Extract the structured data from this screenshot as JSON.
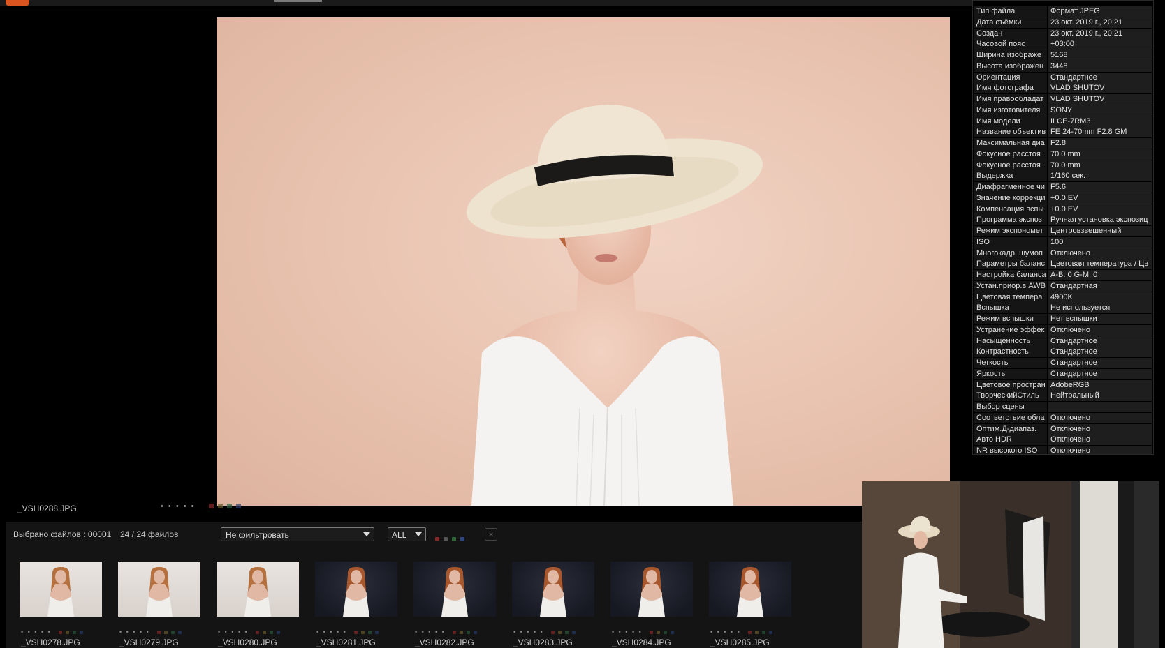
{
  "topbar": {
    "tab_label": ""
  },
  "viewer": {
    "filename": "_VSH0288.JPG",
    "stars": "• • • • •",
    "label_colors": [
      "#8a2a2a",
      "#6a5a2a",
      "#2a5a3a",
      "#2a3a6a"
    ]
  },
  "browser": {
    "selected_label": "Выбрано файлов : 00001",
    "count_label": "24 / 24 файлов",
    "filter_value": "Не фильтровать",
    "rating_value": "ALL",
    "label_filter_colors": [
      "#b03030",
      "#707070",
      "#3a8a4a",
      "#3a5ab0"
    ],
    "clear_icon": "×",
    "thumbnails": [
      {
        "name": "_VSH0278.JPG",
        "tone": "light",
        "stars": "• • • • •"
      },
      {
        "name": "_VSH0279.JPG",
        "tone": "light",
        "stars": "• • • • •"
      },
      {
        "name": "_VSH0280.JPG",
        "tone": "light",
        "stars": "• • • • •"
      },
      {
        "name": "_VSH0281.JPG",
        "tone": "dark",
        "stars": "• • • • •"
      },
      {
        "name": "_VSH0282.JPG",
        "tone": "dark",
        "stars": "• • • • •"
      },
      {
        "name": "_VSH0283.JPG",
        "tone": "dark",
        "stars": "• • • • •"
      },
      {
        "name": "_VSH0284.JPG",
        "tone": "dark",
        "stars": "• • • • •"
      },
      {
        "name": "_VSH0285.JPG",
        "tone": "dark",
        "stars": "• • • • •"
      }
    ]
  },
  "metadata": [
    {
      "key": "Тип файла",
      "value": "Формат JPEG"
    },
    {
      "key": "Дата съёмки",
      "value": "23 окт. 2019 г., 20:21"
    },
    {
      "key": "Создан",
      "value": "23 окт. 2019 г., 20:21"
    },
    {
      "key": "Часовой пояс",
      "value": "+03:00"
    },
    {
      "key": "Ширина изображе",
      "value": "5168"
    },
    {
      "key": "Высота изображен",
      "value": "3448"
    },
    {
      "key": "Ориентация",
      "value": "Стандартное"
    },
    {
      "key": "Имя фотографа",
      "value": "VLAD SHUTOV"
    },
    {
      "key": "Имя правообладат",
      "value": "VLAD SHUTOV"
    },
    {
      "key": "Имя изготовителя",
      "value": "SONY"
    },
    {
      "key": "Имя модели",
      "value": "ILCE-7RM3"
    },
    {
      "key": "Название объектив",
      "value": "FE 24-70mm F2.8 GM"
    },
    {
      "key": "Максимальная диа",
      "value": "F2.8"
    },
    {
      "key": "Фокусное расстоя",
      "value": "70.0 mm"
    },
    {
      "key": "Фокусное расстоя",
      "value": "70.0 mm"
    },
    {
      "key": "Выдержка",
      "value": "1/160 сек."
    },
    {
      "key": "Диафрагменное чи",
      "value": "F5.6"
    },
    {
      "key": "Значение коррекци",
      "value": "+0.0 EV"
    },
    {
      "key": "Компенсация вспы",
      "value": "+0.0 EV"
    },
    {
      "key": "Программа экспоз",
      "value": "Ручная установка экспозиц"
    },
    {
      "key": "Режим экспономет",
      "value": "Центровзвешенный"
    },
    {
      "key": "ISO",
      "value": "100"
    },
    {
      "key": "Многокадр. шумоп",
      "value": "Отключено"
    },
    {
      "key": "Параметры баланс",
      "value": "Цветовая температура / Цв"
    },
    {
      "key": "Настройка баланса",
      "value": "A-B: 0 G-M: 0"
    },
    {
      "key": "Устан.приор.в AWB",
      "value": "Стандартная"
    },
    {
      "key": "Цветовая темпера",
      "value": "4900K"
    },
    {
      "key": "Вспышка",
      "value": "Не используется"
    },
    {
      "key": "Режим вспышки",
      "value": "Нет вспышки"
    },
    {
      "key": "Устранение эффек",
      "value": "Отключено"
    },
    {
      "key": "Насыщенность",
      "value": "Стандартное"
    },
    {
      "key": "Контрастность",
      "value": "Стандартное"
    },
    {
      "key": "Четкость",
      "value": "Стандартное"
    },
    {
      "key": "Яркость",
      "value": "Стандартное"
    },
    {
      "key": "Цветовое простран",
      "value": "AdobeRGB"
    },
    {
      "key": "ТворческийСтиль",
      "value": "Нейтральный"
    },
    {
      "key": "Выбор сцены",
      "value": ""
    },
    {
      "key": "Соответствие обла",
      "value": "Отключено"
    },
    {
      "key": "Оптим.Д-диапаз.",
      "value": "Отключено"
    },
    {
      "key": "Авто HDR",
      "value": "Отключено"
    },
    {
      "key": "NR высокого ISO",
      "value": "Отключено"
    }
  ],
  "colors": {
    "backdrop": "#e8c2ae",
    "accent": "#d9541e"
  }
}
